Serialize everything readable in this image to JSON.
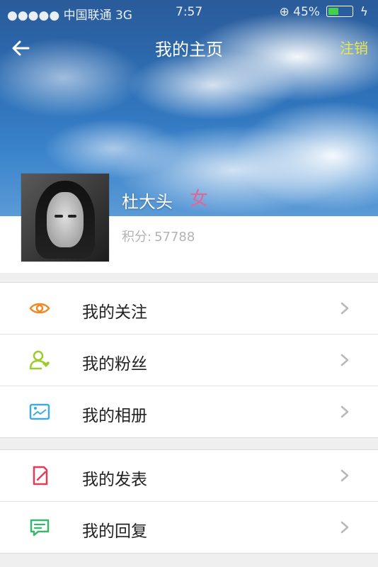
{
  "status_bar": {
    "signal": "●●●●●",
    "carrier": "中国联通",
    "network": "3G",
    "time": "7:57",
    "battery_percent": "45%",
    "battery_level": 0.45
  },
  "nav": {
    "title": "我的主页",
    "logout_label": "注销"
  },
  "profile": {
    "username": "杜大头",
    "gender": "女",
    "points_label": "积分:",
    "points_value": "57788"
  },
  "menu": {
    "group1": [
      {
        "label": "我的关注",
        "icon": "eye-icon",
        "color": "#f08a26"
      },
      {
        "label": "我的粉丝",
        "icon": "user-heart-icon",
        "color": "#9ccc29"
      },
      {
        "label": "我的相册",
        "icon": "photo-icon",
        "color": "#3fa9e0"
      }
    ],
    "group2": [
      {
        "label": "我的发表",
        "icon": "edit-icon",
        "color": "#e43b56"
      },
      {
        "label": "我的回复",
        "icon": "comment-icon",
        "color": "#37b86b"
      }
    ]
  },
  "colors": {
    "accent_logout": "#e7e84b",
    "gender": "#e2669a",
    "points": "#b3b3b3"
  }
}
